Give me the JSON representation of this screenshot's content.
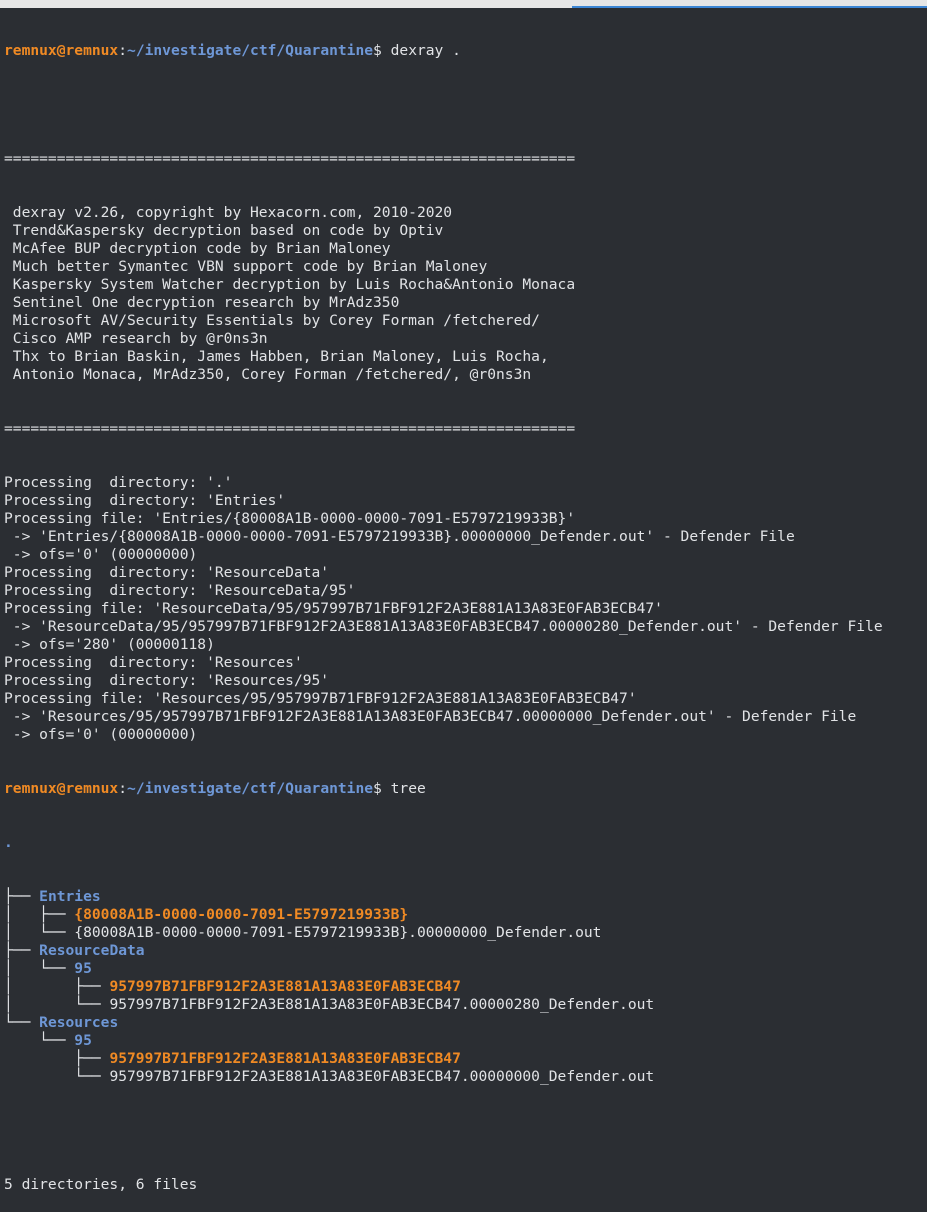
{
  "prompt1": {
    "user": "remnux@remnux",
    "colon": ":",
    "path": "~/investigate/ctf/Quarantine",
    "dollar": "$ ",
    "command": "dexray ."
  },
  "banner": {
    "rule": "=================================================================",
    "lines": [
      " dexray v2.26, copyright by Hexacorn.com, 2010-2020",
      " Trend&Kaspersky decryption based on code by Optiv",
      " McAfee BUP decryption code by Brian Maloney",
      " Much better Symantec VBN support code by Brian Maloney",
      " Kaspersky System Watcher decryption by Luis Rocha&Antonio Monaca",
      " Sentinel One decryption research by MrAdz350",
      " Microsoft AV/Security Essentials by Corey Forman /fetchered/",
      " Cisco AMP research by @r0ns3n",
      " Thx to Brian Baskin, James Habben, Brian Maloney, Luis Rocha,",
      " Antonio Monaca, MrAdz350, Corey Forman /fetchered/, @r0ns3n"
    ]
  },
  "output": [
    "Processing  directory: '.'",
    "Processing  directory: 'Entries'",
    "Processing file: 'Entries/{80008A1B-0000-0000-7091-E5797219933B}'",
    " -> 'Entries/{80008A1B-0000-0000-7091-E5797219933B}.00000000_Defender.out' - Defender File",
    " -> ofs='0' (00000000)",
    "Processing  directory: 'ResourceData'",
    "Processing  directory: 'ResourceData/95'",
    "Processing file: 'ResourceData/95/957997B71FBF912F2A3E881A13A83E0FAB3ECB47'",
    " -> 'ResourceData/95/957997B71FBF912F2A3E881A13A83E0FAB3ECB47.00000280_Defender.out' - Defender File",
    " -> ofs='280' (00000118)",
    "Processing  directory: 'Resources'",
    "Processing  directory: 'Resources/95'",
    "Processing file: 'Resources/95/957997B71FBF912F2A3E881A13A83E0FAB3ECB47'",
    " -> 'Resources/95/957997B71FBF912F2A3E881A13A83E0FAB3ECB47.00000000_Defender.out' - Defender File",
    " -> ofs='0' (00000000)"
  ],
  "prompt2": {
    "user": "remnux@remnux",
    "colon": ":",
    "path": "~/investigate/ctf/Quarantine",
    "dollar": "$ ",
    "command": "tree"
  },
  "tree": {
    "root": ".",
    "rows": [
      {
        "prefix": "├── ",
        "name": "Entries",
        "kind": "dir"
      },
      {
        "prefix": "│   ├── ",
        "name": "{80008A1B-0000-0000-7091-E5797219933B}",
        "kind": "qdir"
      },
      {
        "prefix": "│   └── ",
        "name": "{80008A1B-0000-0000-7091-E5797219933B}.00000000_Defender.out",
        "kind": "file"
      },
      {
        "prefix": "├── ",
        "name": "ResourceData",
        "kind": "dir"
      },
      {
        "prefix": "│   └── ",
        "name": "95",
        "kind": "dir"
      },
      {
        "prefix": "│       ├── ",
        "name": "957997B71FBF912F2A3E881A13A83E0FAB3ECB47",
        "kind": "qdir"
      },
      {
        "prefix": "│       └── ",
        "name": "957997B71FBF912F2A3E881A13A83E0FAB3ECB47.00000280_Defender.out",
        "kind": "file"
      },
      {
        "prefix": "└── ",
        "name": "Resources",
        "kind": "dir"
      },
      {
        "prefix": "    └── ",
        "name": "95",
        "kind": "dir"
      },
      {
        "prefix": "        ├── ",
        "name": "957997B71FBF912F2A3E881A13A83E0FAB3ECB47",
        "kind": "qdir"
      },
      {
        "prefix": "        └── ",
        "name": "957997B71FBF912F2A3E881A13A83E0FAB3ECB47.00000000_Defender.out",
        "kind": "file"
      }
    ],
    "summary": "5 directories, 6 files"
  },
  "colors": {
    "background": "#2b2e33",
    "text": "#e1e3e6",
    "user": "#f08a24",
    "path": "#6e97d6"
  }
}
